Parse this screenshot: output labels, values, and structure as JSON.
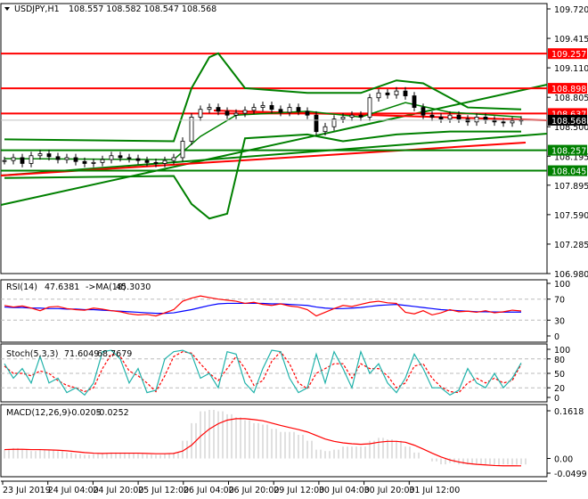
{
  "header": {
    "symbol": "USDJPY,H1",
    "ohlc": "108.557 108.582 108.547 108.568"
  },
  "colors": {
    "up": "#000000",
    "level_red": "#ff0000",
    "level_green": "#008000",
    "band": "#008000",
    "rsi": "#ff0000",
    "rsi_ma": "#0000ff",
    "stoch_k": "#20b2aa",
    "stoch_d": "#ff0000",
    "macd_hist": "#c0c0c0",
    "macd_signal": "#ff0000",
    "axis_text": "#000000"
  },
  "chart_data": [
    {
      "type": "candlestick",
      "name": "USDJPY,H1",
      "ylim": [
        106.98,
        109.72
      ],
      "yticks": [
        "109.720",
        "109.415",
        "109.110",
        "108.805",
        "108.500",
        "108.195",
        "107.895",
        "107.590",
        "107.285",
        "106.980"
      ],
      "xticks": [
        "23 Jul 2019",
        "24 Jul 04:00",
        "24 Jul 20:00",
        "25 Jul 12:00",
        "26 Jul 04:00",
        "26 Jul 20:00",
        "29 Jul 12:00",
        "30 Jul 04:00",
        "30 Jul 20:00",
        "31 Jul 12:00"
      ],
      "closes": [
        108.15,
        108.18,
        108.12,
        108.2,
        108.22,
        108.19,
        108.16,
        108.18,
        108.14,
        108.12,
        108.13,
        108.16,
        108.2,
        108.18,
        108.17,
        108.15,
        108.13,
        108.12,
        108.15,
        108.18,
        108.35,
        108.6,
        108.68,
        108.7,
        108.66,
        108.62,
        108.64,
        108.67,
        108.7,
        108.72,
        108.68,
        108.65,
        108.7,
        108.66,
        108.62,
        108.45,
        108.5,
        108.58,
        108.6,
        108.62,
        108.6,
        108.8,
        108.85,
        108.83,
        108.87,
        108.82,
        108.7,
        108.62,
        108.6,
        108.58,
        108.62,
        108.58,
        108.55,
        108.6,
        108.57,
        108.55,
        108.54,
        108.56,
        108.57
      ],
      "current_price": "108.568",
      "levels": [
        {
          "value": "109.257",
          "color": "red"
        },
        {
          "value": "108.898",
          "color": "red"
        },
        {
          "value": "108.637",
          "color": "red"
        },
        {
          "value": "108.257",
          "color": "green"
        },
        {
          "value": "108.045",
          "color": "green"
        }
      ],
      "bollinger": {
        "upper": [
          [
            0,
            108.37
          ],
          [
            19,
            108.35
          ],
          [
            21,
            108.9
          ],
          [
            23,
            109.22
          ],
          [
            24,
            109.26
          ],
          [
            27,
            108.9
          ],
          [
            34,
            108.85
          ],
          [
            40,
            108.85
          ],
          [
            44,
            108.98
          ],
          [
            47,
            108.95
          ],
          [
            52,
            108.7
          ],
          [
            58,
            108.68
          ]
        ],
        "middle": [
          [
            0,
            108.17
          ],
          [
            19,
            108.16
          ],
          [
            22,
            108.4
          ],
          [
            26,
            108.62
          ],
          [
            34,
            108.66
          ],
          [
            40,
            108.6
          ],
          [
            45,
            108.75
          ],
          [
            50,
            108.65
          ],
          [
            58,
            108.6
          ]
        ],
        "lower": [
          [
            0,
            107.97
          ],
          [
            19,
            107.99
          ],
          [
            21,
            107.7
          ],
          [
            23,
            107.55
          ],
          [
            25,
            107.6
          ],
          [
            27,
            108.38
          ],
          [
            34,
            108.42
          ],
          [
            38,
            108.35
          ],
          [
            44,
            108.42
          ],
          [
            50,
            108.45
          ],
          [
            58,
            108.45
          ]
        ]
      }
    },
    {
      "type": "line",
      "name": "RSI(14)",
      "value": "47.6381",
      "ma_label": "->MA(18)",
      "ma_value": "45.3030",
      "ylim": [
        0,
        100
      ],
      "yticks": [
        "100",
        "70",
        "30",
        "0"
      ],
      "rsi": [
        58,
        55,
        57,
        53,
        48,
        55,
        56,
        52,
        50,
        49,
        53,
        51,
        48,
        46,
        42,
        40,
        41,
        38,
        44,
        50,
        66,
        72,
        76,
        73,
        70,
        68,
        66,
        62,
        64,
        60,
        58,
        61,
        57,
        55,
        50,
        38,
        45,
        52,
        58,
        56,
        60,
        64,
        66,
        63,
        62,
        45,
        42,
        48,
        40,
        44,
        50,
        46,
        47,
        45,
        48,
        44,
        46,
        49,
        47.6
      ],
      "ma": [
        55,
        54,
        54,
        53,
        53,
        52,
        52,
        51,
        51,
        50,
        50,
        49,
        48,
        47,
        46,
        45,
        44,
        43,
        43,
        44,
        47,
        50,
        54,
        58,
        61,
        62,
        62,
        62,
        62,
        62,
        61,
        61,
        60,
        59,
        58,
        55,
        53,
        52,
        52,
        53,
        54,
        56,
        58,
        59,
        60,
        58,
        56,
        54,
        52,
        50,
        49,
        48,
        47,
        46,
        46,
        45.5,
        45.3,
        45.3,
        45.3
      ]
    },
    {
      "type": "line",
      "name": "Stoch(5,3,3)",
      "k_value": "71.6049",
      "d_value": "68.7679",
      "ylim": [
        0,
        100
      ],
      "yticks": [
        "100",
        "80",
        "50",
        "20",
        "0"
      ],
      "k": [
        70,
        40,
        60,
        30,
        85,
        30,
        40,
        10,
        20,
        5,
        30,
        95,
        98,
        80,
        30,
        60,
        10,
        15,
        80,
        95,
        98,
        90,
        40,
        50,
        20,
        95,
        90,
        30,
        10,
        60,
        98,
        95,
        40,
        10,
        20,
        90,
        30,
        95,
        60,
        20,
        95,
        50,
        70,
        30,
        10,
        40,
        90,
        60,
        20,
        20,
        5,
        15,
        60,
        30,
        20,
        50,
        20,
        40,
        71.6
      ],
      "d": [
        65,
        50,
        50,
        45,
        55,
        50,
        35,
        25,
        20,
        12,
        20,
        60,
        90,
        85,
        55,
        45,
        30,
        12,
        45,
        85,
        95,
        92,
        70,
        50,
        35,
        60,
        85,
        60,
        25,
        35,
        75,
        95,
        70,
        30,
        18,
        50,
        60,
        70,
        70,
        40,
        70,
        60,
        60,
        45,
        20,
        30,
        65,
        70,
        40,
        22,
        12,
        10,
        30,
        40,
        30,
        40,
        30,
        35,
        68.8
      ]
    },
    {
      "type": "bar",
      "name": "MACD(12,26,9)",
      "macd_value": "-0.0205",
      "signal_value": "-0.0252",
      "ylim": [
        -0.0499,
        0.1618
      ],
      "yticks": [
        "0.1618",
        "0.00",
        "-0.0499"
      ],
      "hist": [
        0.03,
        0.035,
        0.03,
        0.025,
        0.03,
        0.028,
        0.025,
        0.02,
        0.015,
        0.012,
        0.015,
        0.018,
        0.02,
        0.02,
        0.018,
        0.016,
        0.013,
        0.012,
        0.015,
        0.02,
        0.06,
        0.12,
        0.16,
        0.165,
        0.16,
        0.15,
        0.14,
        0.13,
        0.12,
        0.115,
        0.1,
        0.09,
        0.09,
        0.08,
        0.06,
        0.03,
        0.025,
        0.03,
        0.04,
        0.04,
        0.04,
        0.06,
        0.07,
        0.065,
        0.06,
        0.04,
        0.02,
        0.0,
        -0.01,
        -0.02,
        -0.015,
        -0.02,
        -0.02,
        -0.018,
        -0.02,
        -0.022,
        -0.02,
        -0.021,
        -0.0205
      ],
      "signal": [
        0.03,
        0.031,
        0.031,
        0.03,
        0.03,
        0.029,
        0.028,
        0.026,
        0.023,
        0.02,
        0.018,
        0.017,
        0.018,
        0.018,
        0.018,
        0.018,
        0.017,
        0.016,
        0.016,
        0.017,
        0.025,
        0.045,
        0.075,
        0.1,
        0.118,
        0.13,
        0.135,
        0.135,
        0.132,
        0.128,
        0.12,
        0.112,
        0.105,
        0.098,
        0.09,
        0.078,
        0.066,
        0.058,
        0.053,
        0.05,
        0.048,
        0.05,
        0.055,
        0.058,
        0.058,
        0.055,
        0.045,
        0.032,
        0.018,
        0.005,
        -0.005,
        -0.012,
        -0.017,
        -0.02,
        -0.022,
        -0.024,
        -0.025,
        -0.025,
        -0.0252
      ]
    }
  ]
}
